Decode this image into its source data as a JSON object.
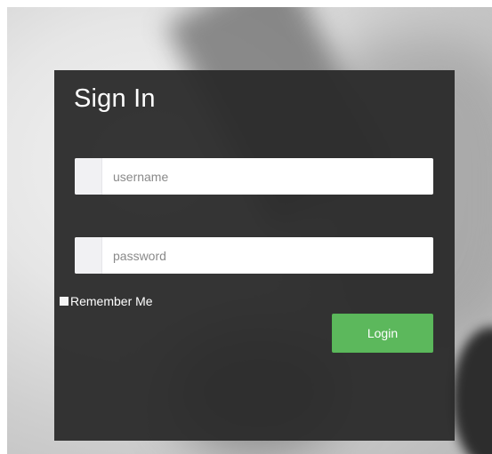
{
  "signin": {
    "title": "Sign In",
    "username": {
      "placeholder": "username",
      "value": ""
    },
    "password": {
      "placeholder": "password",
      "value": ""
    },
    "remember_label": "Remember Me",
    "remember_checked": false,
    "login_label": "Login"
  },
  "colors": {
    "panel_background": "#2a2a2a",
    "login_button": "#5cb85c",
    "input_addon": "#f1f1f3",
    "text_light": "#ffffff"
  }
}
